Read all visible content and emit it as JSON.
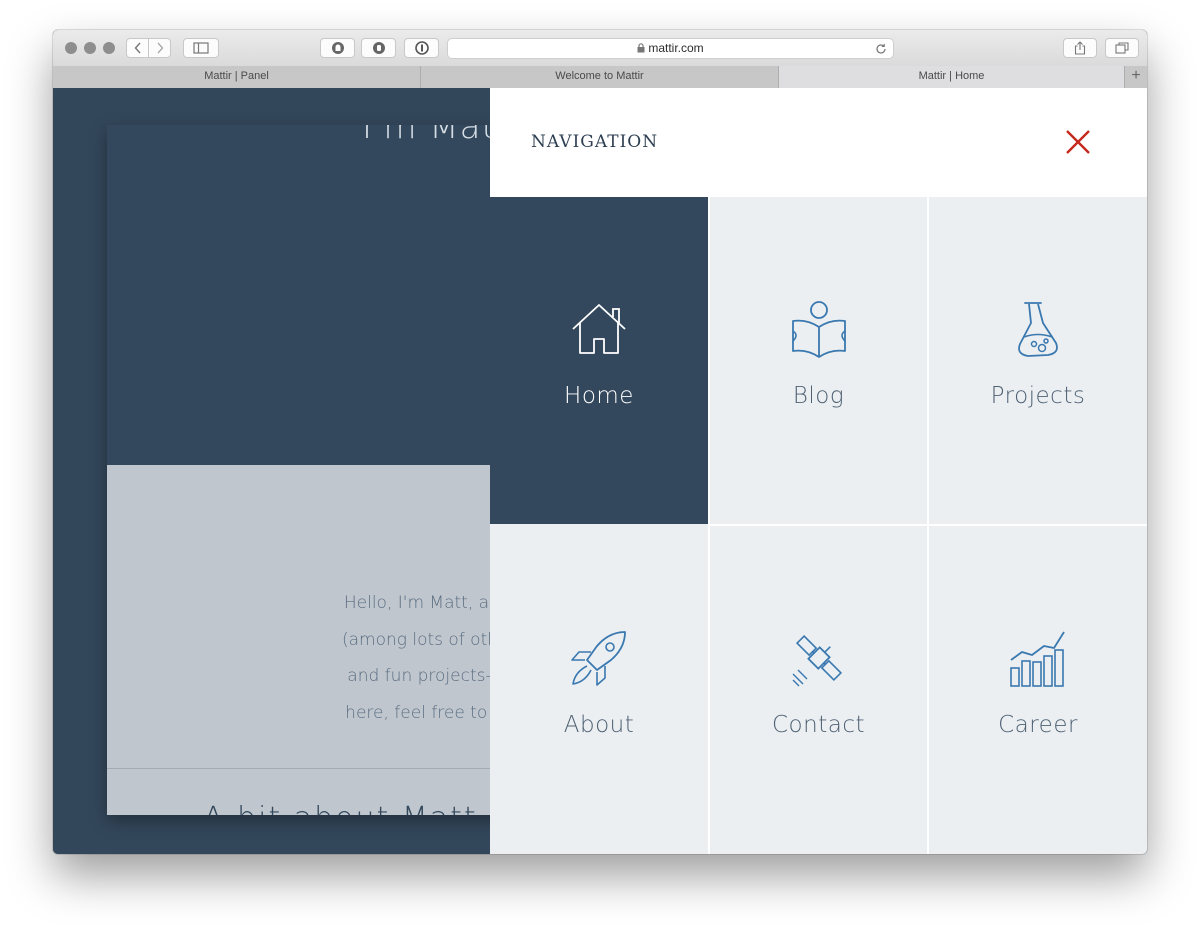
{
  "browser": {
    "address": "mattir.com",
    "tabs": [
      {
        "label": "Mattir | Panel",
        "active": false
      },
      {
        "label": "Welcome to Mattir",
        "active": false
      },
      {
        "label": "Mattir | Home",
        "active": true
      }
    ],
    "new_tab_label": "+"
  },
  "page": {
    "hero_title": "I'm Matt",
    "intro_lines": [
      "Hello, I'm Matt, a fella from Atlanta",
      "(among lots of other things). This is",
      "and fun projects—or other things I",
      "here, feel free to leave a comment"
    ],
    "section_title": "A bit about Matt"
  },
  "navigation": {
    "title": "NAVIGATION",
    "items": [
      {
        "label": "Home",
        "icon": "house-icon",
        "active": true
      },
      {
        "label": "Blog",
        "icon": "reading-person-icon",
        "active": false
      },
      {
        "label": "Projects",
        "icon": "flask-icon",
        "active": false
      },
      {
        "label": "About",
        "icon": "rocket-icon",
        "active": false
      },
      {
        "label": "Contact",
        "icon": "satellite-icon",
        "active": false
      },
      {
        "label": "Career",
        "icon": "bar-chart-icon",
        "active": false
      }
    ]
  },
  "colors": {
    "dark_navy": "#33485c",
    "panel_bg": "#ebeff2",
    "icon_blue": "#3a78b0",
    "close_red": "#c5281c"
  }
}
